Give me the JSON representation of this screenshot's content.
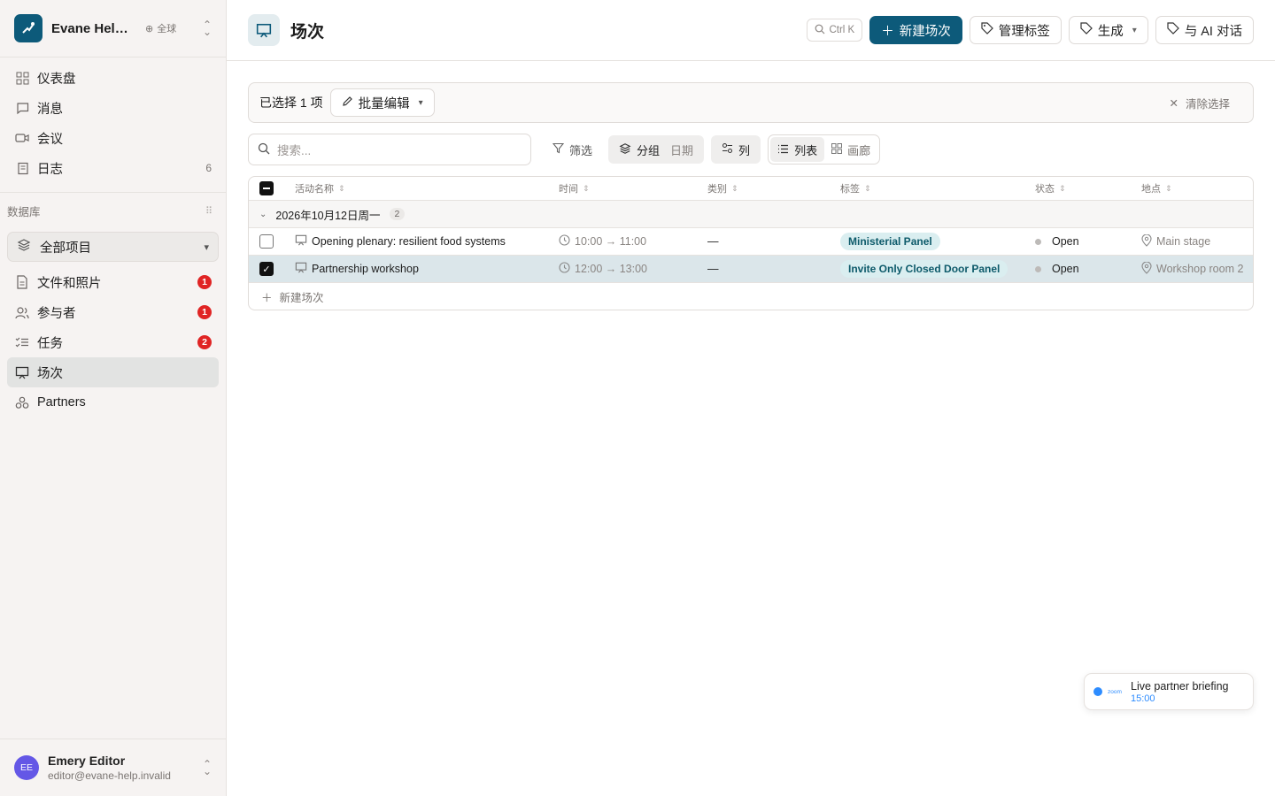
{
  "workspace": {
    "name": "Evane Help ...",
    "scope": "全球"
  },
  "nav": [
    {
      "label": "仪表盘",
      "icon": "grid-icon"
    },
    {
      "label": "消息",
      "icon": "chat-icon"
    },
    {
      "label": "会议",
      "icon": "video-icon"
    },
    {
      "label": "日志",
      "icon": "log-icon",
      "count": "6"
    }
  ],
  "database": {
    "heading": "数据库",
    "project_selector": "全部项目",
    "items": [
      {
        "label": "文件和照片",
        "icon": "file-icon",
        "badge": "1"
      },
      {
        "label": "参与者",
        "icon": "users-icon",
        "badge": "1"
      },
      {
        "label": "任务",
        "icon": "tasks-icon",
        "badge": "2"
      },
      {
        "label": "场次",
        "icon": "presentation-icon",
        "active": true
      },
      {
        "label": "Partners",
        "icon": "partners-icon"
      }
    ]
  },
  "user": {
    "initials": "EE",
    "name": "Emery Editor",
    "email": "editor@evane-help.invalid"
  },
  "header": {
    "title": "场次",
    "shortcut": "Ctrl K",
    "new_button": "新建场次",
    "manage_tags": "管理标签",
    "generate": "生成",
    "ai_chat": "与 AI 对话"
  },
  "selection": {
    "count_label": "已选择 1 项",
    "bulk_edit": "批量编辑",
    "clear": "清除选择"
  },
  "toolbar": {
    "search_placeholder": "搜索...",
    "filter": "筛选",
    "group": "分组",
    "group_by": "日期",
    "columns": "列",
    "view_list": "列表",
    "view_gallery": "画廊"
  },
  "table": {
    "columns": [
      "活动名称",
      "时间",
      "类别",
      "标签",
      "状态",
      "地点"
    ],
    "group": {
      "label": "2026年10月12日周一",
      "count": "2"
    },
    "rows": [
      {
        "name": "Opening plenary: resilient food systems",
        "time": "10:00 → 11:00",
        "category": "—",
        "tag": "Ministerial Panel",
        "status": "Open",
        "location": "Main stage",
        "selected": false
      },
      {
        "name": "Partnership workshop",
        "time": "12:00 → 13:00",
        "category": "—",
        "tag": "Invite Only Closed Door Panel",
        "status": "Open",
        "location": "Workshop room 2",
        "selected": true
      }
    ],
    "add_row": "新建场次"
  },
  "toast": {
    "brand": "zoom",
    "title": "Live partner briefing",
    "time": "15:00"
  },
  "colors": {
    "brand": "#0d5a7a",
    "badge": "#e02424",
    "selected_row": "#dbe6ea",
    "tag_bg": "#daeef0",
    "zoom": "#2d8cff"
  }
}
